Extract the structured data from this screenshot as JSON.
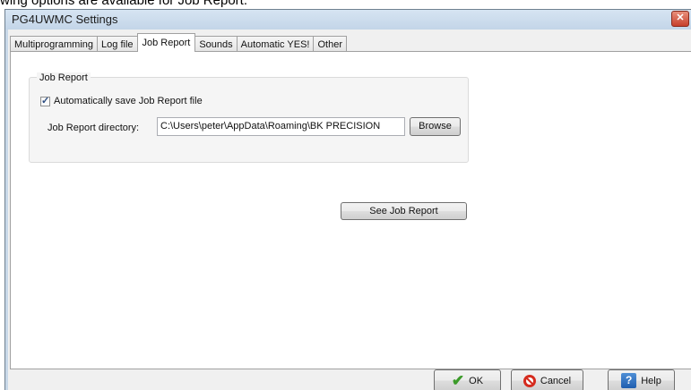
{
  "doc_caption": "wing options are available for Job Report.",
  "window": {
    "title": "PG4UWMC Settings",
    "close_glyph": "✕"
  },
  "tabs": [
    {
      "label": "Multiprogramming",
      "active": false
    },
    {
      "label": "Log file",
      "active": false
    },
    {
      "label": "Job Report",
      "active": true
    },
    {
      "label": "Sounds",
      "active": false
    },
    {
      "label": "Automatic YES!",
      "active": false
    },
    {
      "label": "Other",
      "active": false
    }
  ],
  "job_report": {
    "group_title": "Job Report",
    "auto_save_label": "Automatically save Job Report file",
    "auto_save_checked": true,
    "directory_label": "Job Report directory:",
    "directory_value": "C:\\Users\\peter\\AppData\\Roaming\\BK PRECISION",
    "browse_label": "Browse",
    "see_report_label": "See Job Report"
  },
  "buttons": {
    "ok": "OK",
    "cancel": "Cancel",
    "help": "Help"
  },
  "icons": {
    "ok": "checkmark-icon",
    "cancel": "cancel-icon",
    "help": "help-icon",
    "close": "close-icon",
    "checkbox": "checkmark-icon"
  },
  "colors": {
    "ok_icon": "#3c9b2a",
    "cancel_icon": "#d52b1e",
    "help_icon": "#1f5eaf",
    "close_button": "#c7402c"
  }
}
